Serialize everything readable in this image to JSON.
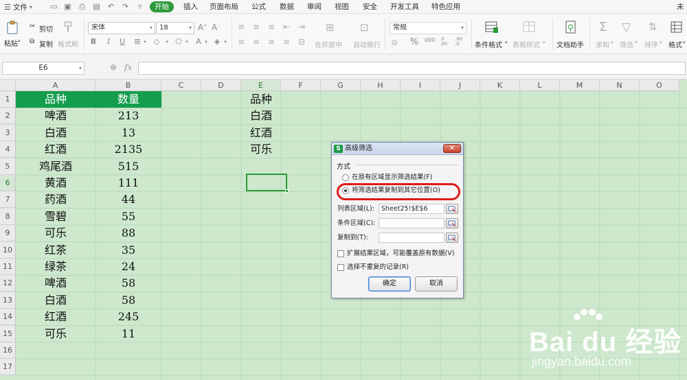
{
  "menubar": {
    "file_label": "文件",
    "tabs": [
      "开始",
      "插入",
      "页面布局",
      "公式",
      "数据",
      "审阅",
      "视图",
      "安全",
      "开发工具",
      "特色应用"
    ],
    "active_tab": "开始",
    "right_char": "未"
  },
  "ribbon": {
    "paste": "粘贴",
    "cut": "剪切",
    "copy": "复制",
    "format_painter": "格式刷",
    "font_name": "宋体",
    "font_size": "18",
    "merge_center": "合并居中",
    "wrap_text": "自动换行",
    "number_format": "常规",
    "conditional_format": "条件格式",
    "table_style": "表格样式",
    "doc_helper": "文档助手",
    "sum": "求和",
    "filter": "筛选",
    "sort": "排序",
    "format": "格式",
    "bold": "B",
    "italic": "I",
    "underline": "U",
    "percent": "%",
    "thousands": "000",
    "inc_decimal": ".0 .00",
    "dec_decimal": ".00 .0"
  },
  "formula_bar": {
    "cell_ref": "E6",
    "fx_label": "fx",
    "value": ""
  },
  "sheet": {
    "columns": [
      "A",
      "B",
      "C",
      "D",
      "E",
      "F",
      "G",
      "H",
      "I",
      "J",
      "K",
      "L",
      "M",
      "N",
      "O"
    ],
    "rows": [
      "1",
      "2",
      "3",
      "4",
      "5",
      "6",
      "7",
      "8",
      "9",
      "10",
      "11",
      "12",
      "13",
      "14",
      "15",
      "16",
      "17"
    ],
    "selected_col": "E",
    "selected_row": "6",
    "table": {
      "headers": [
        "品种",
        "数量"
      ],
      "rows": [
        [
          "啤酒",
          "213"
        ],
        [
          "白酒",
          "13"
        ],
        [
          "红酒",
          "2135"
        ],
        [
          "鸡尾酒",
          "515"
        ],
        [
          "黄酒",
          "111"
        ],
        [
          "药酒",
          "44"
        ],
        [
          "雪碧",
          "55"
        ],
        [
          "可乐",
          "88"
        ],
        [
          "红茶",
          "35"
        ],
        [
          "绿茶",
          "24"
        ],
        [
          "啤酒",
          "58"
        ],
        [
          "白酒",
          "58"
        ],
        [
          "红酒",
          "245"
        ],
        [
          "可乐",
          "11"
        ]
      ]
    },
    "criteria": [
      "品种",
      "白酒",
      "红酒",
      "可乐"
    ]
  },
  "dialog": {
    "title": "高级筛选",
    "group_label": "方式",
    "option_in_place": "在原有区域显示筛选结果(F)",
    "option_copy": "将筛选结果复制到其它位置(O)",
    "selected_option": "copy",
    "list_range_label": "列表区域(L):",
    "list_range_value": "Sheet25!$E$6",
    "criteria_range_label": "条件区域(C):",
    "criteria_range_value": "",
    "copy_to_label": "复制到(T):",
    "copy_to_value": "",
    "expand_label": "扩展结果区域，可能覆盖原有数据(V)",
    "unique_label": "选择不重复的记录(R)",
    "ok_label": "确定",
    "cancel_label": "取消"
  },
  "watermark": {
    "brand": "Bai du 经验",
    "url": "jingyan.baidu.com"
  },
  "colors": {
    "accent": "#2c9a3a",
    "header_fill": "#139d4c",
    "sheet_bg": "#cde8cd",
    "highlight_ring": "#e01919"
  }
}
